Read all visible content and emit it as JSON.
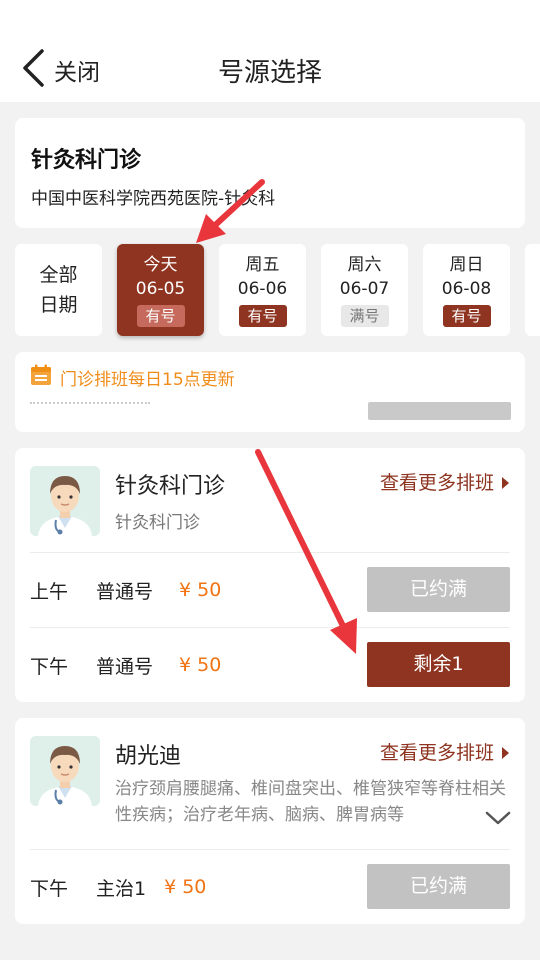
{
  "header": {
    "back_label": "关闭",
    "title": "号源选择"
  },
  "department": {
    "name": "针灸科门诊",
    "hospital_dept": "中国中医科学院西苑医院-针灸科"
  },
  "dates": {
    "all_label_line1": "全部",
    "all_label_line2": "日期",
    "days": [
      {
        "weekday": "今天",
        "date": "06-05",
        "status": "有号",
        "selected": true
      },
      {
        "weekday": "周五",
        "date": "06-06",
        "status": "有号",
        "selected": false
      },
      {
        "weekday": "周六",
        "date": "06-07",
        "status": "满号",
        "selected": false
      },
      {
        "weekday": "周日",
        "date": "06-08",
        "status": "有号",
        "selected": false
      }
    ]
  },
  "notice": {
    "text": "门诊排班每日15点更新"
  },
  "doctors": [
    {
      "name": "针灸科门诊",
      "subtitle": "针灸科门诊",
      "more_label": "查看更多排班",
      "slots": [
        {
          "period": "上午",
          "type": "普通号",
          "price": "¥ 50",
          "button": "已约满",
          "available": false
        },
        {
          "period": "下午",
          "type": "普通号",
          "price": "¥ 50",
          "button": "剩余1",
          "available": true
        }
      ]
    },
    {
      "name": "胡光迪",
      "description": "治疗颈肩腰腿痛、椎间盘突出、椎管狭窄等脊柱相关性疾病；治疗老年病、脑病、脾胃病等",
      "more_label": "查看更多排班",
      "slots": [
        {
          "period": "下午",
          "type": "主治1",
          "price": "¥ 50",
          "button": "已约满",
          "available": false
        }
      ]
    }
  ],
  "colors": {
    "accent": "#8e3420",
    "price": "#f07414",
    "notice": "#f08c1a",
    "annotation_arrow": "#e8363c"
  }
}
